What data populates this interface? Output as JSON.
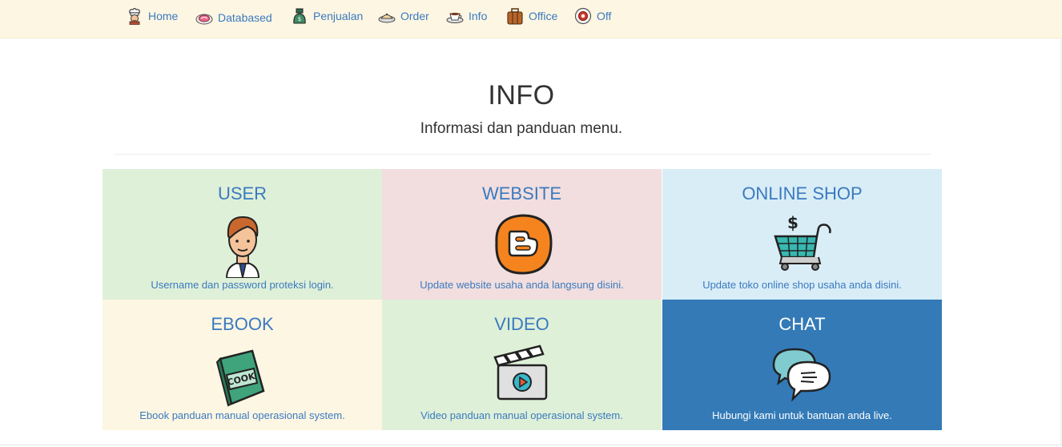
{
  "nav": {
    "items": [
      {
        "label": "Home",
        "icon": "chef-icon"
      },
      {
        "label": "Databased",
        "icon": "meat-plate-icon"
      },
      {
        "label": "Penjualan",
        "icon": "money-bag-icon"
      },
      {
        "label": "Order",
        "icon": "food-tray-icon"
      },
      {
        "label": "Info",
        "icon": "coffee-cup-icon"
      },
      {
        "label": "Office",
        "icon": "briefcase-icon"
      },
      {
        "label": "Off",
        "icon": "power-icon"
      }
    ]
  },
  "header": {
    "title": "INFO",
    "subtitle": "Informasi dan panduan menu."
  },
  "tiles": [
    {
      "title": "USER",
      "desc": "Username dan password proteksi login.",
      "icon": "user-avatar-icon",
      "bg": "#dff0d8"
    },
    {
      "title": "WEBSITE",
      "desc": "Update website usaha anda langsung disini.",
      "icon": "blogger-icon",
      "bg": "#f2dede"
    },
    {
      "title": "ONLINE SHOP",
      "desc": "Update toko online shop usaha anda disini.",
      "icon": "shopping-cart-icon",
      "bg": "#d9edf7"
    },
    {
      "title": "EBOOK",
      "desc": "Ebook panduan manual operasional system.",
      "icon": "cook-book-icon",
      "bg": "#fdf6e3"
    },
    {
      "title": "VIDEO",
      "desc": "Video panduan manual operasional system.",
      "icon": "video-clapper-icon",
      "bg": "#dff0d8"
    },
    {
      "title": "CHAT",
      "desc": "Hubungi kami untuk bantuan anda live.",
      "icon": "chat-bubbles-icon",
      "bg": "#337ab7"
    }
  ],
  "colors": {
    "navbar_bg": "#fdf6e3",
    "link": "#3a7abf",
    "chat_bg": "#337ab7"
  }
}
